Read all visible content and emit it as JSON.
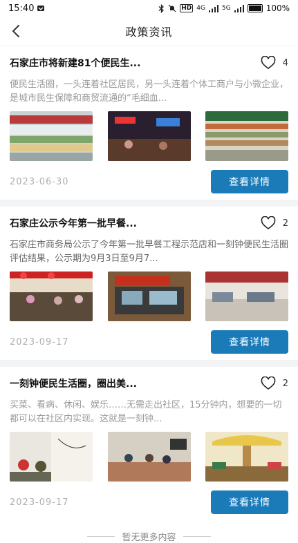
{
  "status_bar": {
    "time": "15:40",
    "battery": "100%",
    "signal_label": "HD",
    "network_4g": "4G",
    "network_5g": "5G"
  },
  "header": {
    "title": "政策资讯"
  },
  "articles": [
    {
      "title": "石家庄市将新建81个便民生...",
      "likes": "4",
      "summary": "便民生活圈，一头连着社区居民，另一头连着个体工商户与小微企业，是城市民生保障和商贸流通的“毛细血...",
      "date": "2023-06-30",
      "button": "查看详情"
    },
    {
      "title": "石家庄公示今年第一批早餐...",
      "likes": "2",
      "summary": "石家庄市商务局公示了今年第一批早餐工程示范店和一刻钟便民生活圈评估结果，公示期为9月3日至9月7...",
      "date": "2023-09-17",
      "button": "查看详情"
    },
    {
      "title": "一刻钟便民生活圈，圈出美...",
      "likes": "2",
      "summary": "买菜、看病、休闲、娱乐……无需走出社区，15分钟内，想要的一切都可以在社区内实现。这就是一刻钟...",
      "date": "2023-09-17",
      "button": "查看详情"
    }
  ],
  "footer": {
    "end_text": "暂无更多内容"
  },
  "icons": [
    "back-icon",
    "heart-icon",
    "bluetooth-icon",
    "mute-icon",
    "wifi-icon",
    "battery-icon"
  ]
}
